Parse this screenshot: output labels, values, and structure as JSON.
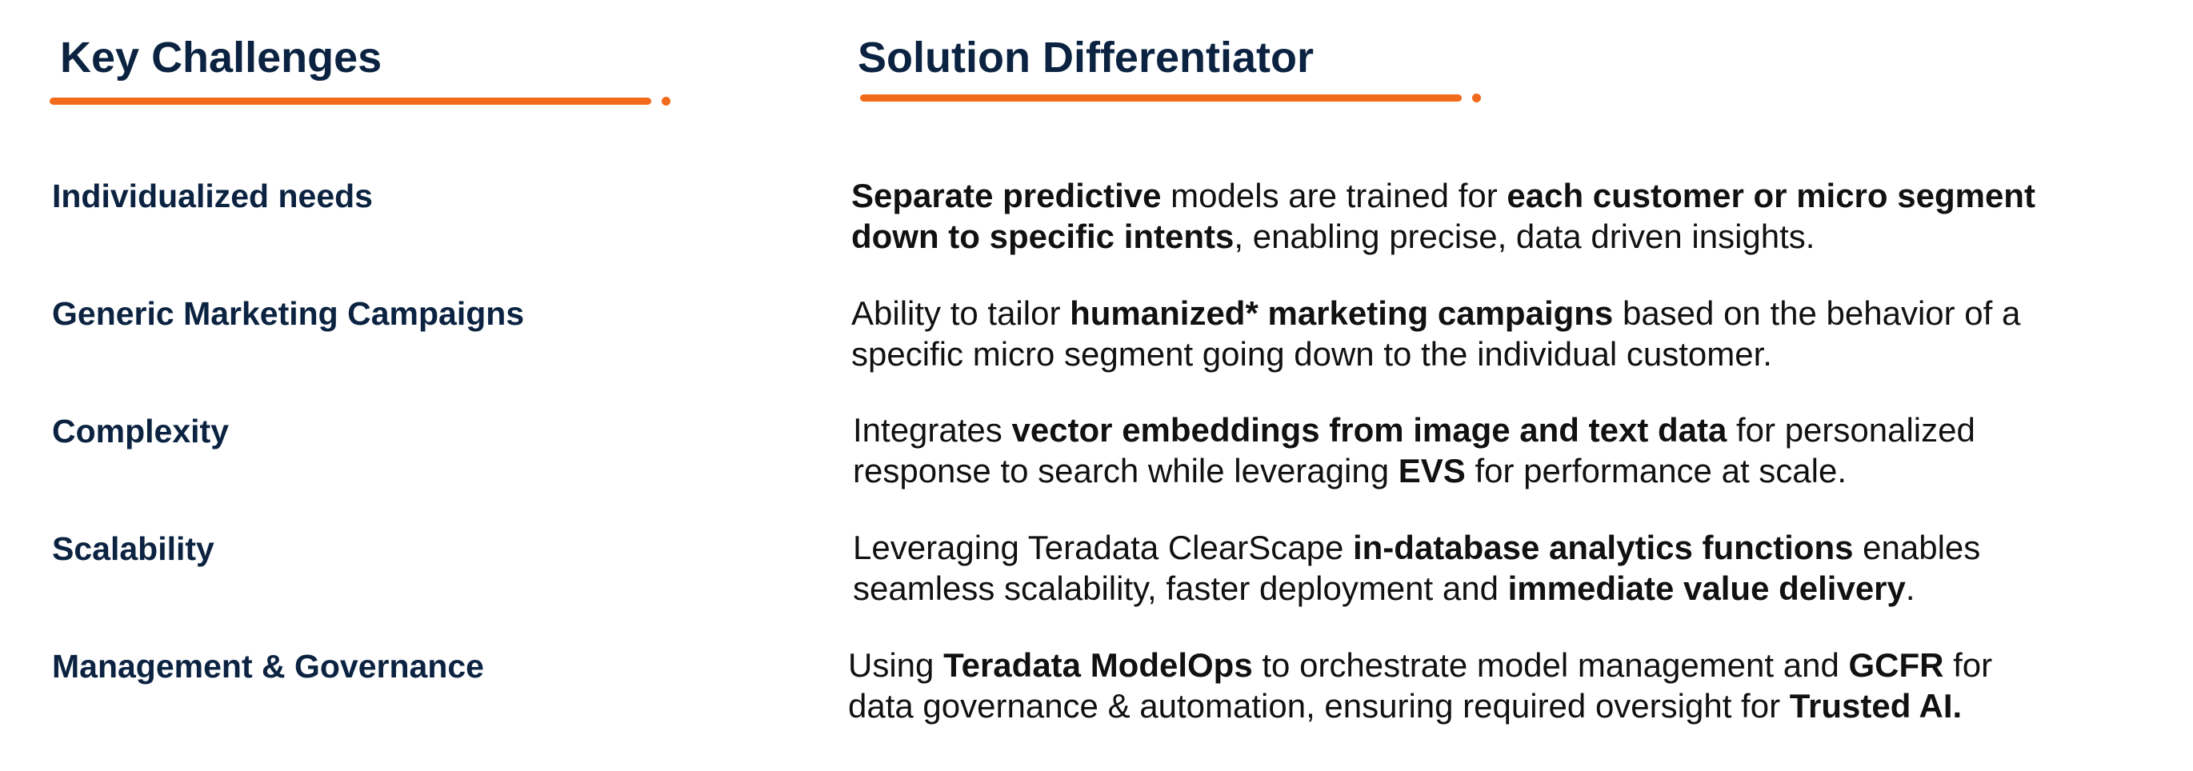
{
  "colors": {
    "heading": "#0b2341",
    "accent": "#f26a1b",
    "body_text": "#111111",
    "background": "#ffffff"
  },
  "left": {
    "heading": "Key Challenges",
    "items": [
      "Individualized needs",
      "Generic Marketing Campaigns",
      "Complexity",
      "Scalability",
      "Management & Governance"
    ]
  },
  "right": {
    "heading": "Solution Differentiator",
    "items": [
      {
        "lines": [
          [
            {
              "t": "Separate predictive",
              "b": true
            },
            {
              "t": " models are trained for ",
              "b": false
            },
            {
              "t": "each customer or micro segment",
              "b": true
            }
          ],
          [
            {
              "t": "down to specific intents",
              "b": true
            },
            {
              "t": ", enabling precise, data driven insights.",
              "b": false
            }
          ]
        ]
      },
      {
        "lines": [
          [
            {
              "t": "Ability to tailor ",
              "b": false
            },
            {
              "t": "humanized* marketing campaigns",
              "b": true
            },
            {
              "t": " based on the behavior of a",
              "b": false
            }
          ],
          [
            {
              "t": "specific micro segment going down to the individual customer.",
              "b": false
            }
          ]
        ]
      },
      {
        "lines": [
          [
            {
              "t": "Integrates ",
              "b": false
            },
            {
              "t": "vector embeddings from image and text data",
              "b": true
            },
            {
              "t": " for personalized",
              "b": false
            }
          ],
          [
            {
              "t": "response to search while leveraging ",
              "b": false
            },
            {
              "t": "EVS",
              "b": true
            },
            {
              "t": " for performance at scale.",
              "b": false
            }
          ]
        ]
      },
      {
        "lines": [
          [
            {
              "t": "Leveraging Teradata ClearScape ",
              "b": false
            },
            {
              "t": "in-database analytics functions",
              "b": true
            },
            {
              "t": " enables",
              "b": false
            }
          ],
          [
            {
              "t": "seamless scalability, faster deployment and ",
              "b": false
            },
            {
              "t": "immediate value delivery",
              "b": true
            },
            {
              "t": ".",
              "b": false
            }
          ]
        ]
      },
      {
        "lines": [
          [
            {
              "t": "Using ",
              "b": false
            },
            {
              "t": "Teradata ModelOps",
              "b": true
            },
            {
              "t": " to orchestrate model management and ",
              "b": false
            },
            {
              "t": "GCFR",
              "b": true
            },
            {
              "t": " for",
              "b": false
            }
          ],
          [
            {
              "t": "data governance & automation, ensuring required oversight for ",
              "b": false
            },
            {
              "t": "Trusted AI.",
              "b": true
            }
          ]
        ]
      }
    ]
  }
}
